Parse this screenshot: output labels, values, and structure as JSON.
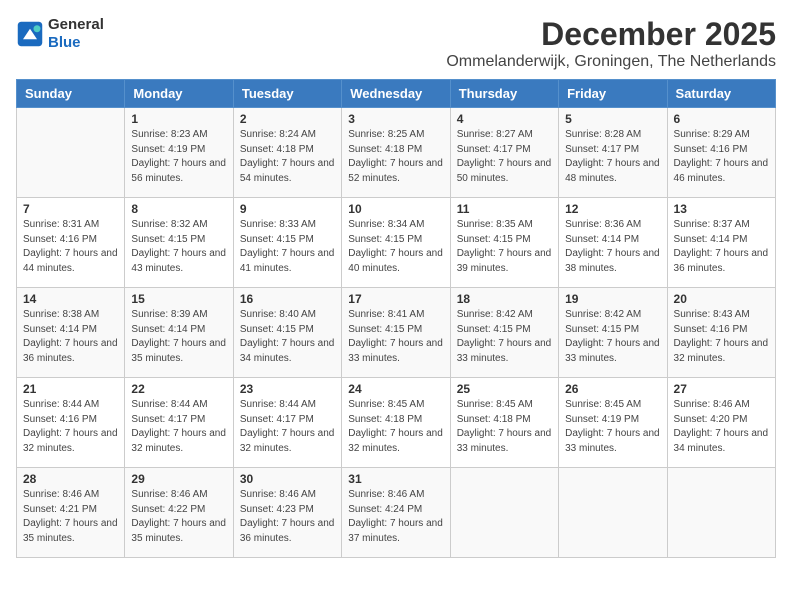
{
  "logo": {
    "line1": "General",
    "line2": "Blue"
  },
  "header": {
    "month": "December 2025",
    "location": "Ommelanderwijk, Groningen, The Netherlands"
  },
  "weekdays": [
    "Sunday",
    "Monday",
    "Tuesday",
    "Wednesday",
    "Thursday",
    "Friday",
    "Saturday"
  ],
  "weeks": [
    [
      {
        "day": "",
        "sunrise": "",
        "sunset": "",
        "daylight": ""
      },
      {
        "day": "1",
        "sunrise": "Sunrise: 8:23 AM",
        "sunset": "Sunset: 4:19 PM",
        "daylight": "Daylight: 7 hours and 56 minutes."
      },
      {
        "day": "2",
        "sunrise": "Sunrise: 8:24 AM",
        "sunset": "Sunset: 4:18 PM",
        "daylight": "Daylight: 7 hours and 54 minutes."
      },
      {
        "day": "3",
        "sunrise": "Sunrise: 8:25 AM",
        "sunset": "Sunset: 4:18 PM",
        "daylight": "Daylight: 7 hours and 52 minutes."
      },
      {
        "day": "4",
        "sunrise": "Sunrise: 8:27 AM",
        "sunset": "Sunset: 4:17 PM",
        "daylight": "Daylight: 7 hours and 50 minutes."
      },
      {
        "day": "5",
        "sunrise": "Sunrise: 8:28 AM",
        "sunset": "Sunset: 4:17 PM",
        "daylight": "Daylight: 7 hours and 48 minutes."
      },
      {
        "day": "6",
        "sunrise": "Sunrise: 8:29 AM",
        "sunset": "Sunset: 4:16 PM",
        "daylight": "Daylight: 7 hours and 46 minutes."
      }
    ],
    [
      {
        "day": "7",
        "sunrise": "Sunrise: 8:31 AM",
        "sunset": "Sunset: 4:16 PM",
        "daylight": "Daylight: 7 hours and 44 minutes."
      },
      {
        "day": "8",
        "sunrise": "Sunrise: 8:32 AM",
        "sunset": "Sunset: 4:15 PM",
        "daylight": "Daylight: 7 hours and 43 minutes."
      },
      {
        "day": "9",
        "sunrise": "Sunrise: 8:33 AM",
        "sunset": "Sunset: 4:15 PM",
        "daylight": "Daylight: 7 hours and 41 minutes."
      },
      {
        "day": "10",
        "sunrise": "Sunrise: 8:34 AM",
        "sunset": "Sunset: 4:15 PM",
        "daylight": "Daylight: 7 hours and 40 minutes."
      },
      {
        "day": "11",
        "sunrise": "Sunrise: 8:35 AM",
        "sunset": "Sunset: 4:15 PM",
        "daylight": "Daylight: 7 hours and 39 minutes."
      },
      {
        "day": "12",
        "sunrise": "Sunrise: 8:36 AM",
        "sunset": "Sunset: 4:14 PM",
        "daylight": "Daylight: 7 hours and 38 minutes."
      },
      {
        "day": "13",
        "sunrise": "Sunrise: 8:37 AM",
        "sunset": "Sunset: 4:14 PM",
        "daylight": "Daylight: 7 hours and 36 minutes."
      }
    ],
    [
      {
        "day": "14",
        "sunrise": "Sunrise: 8:38 AM",
        "sunset": "Sunset: 4:14 PM",
        "daylight": "Daylight: 7 hours and 36 minutes."
      },
      {
        "day": "15",
        "sunrise": "Sunrise: 8:39 AM",
        "sunset": "Sunset: 4:14 PM",
        "daylight": "Daylight: 7 hours and 35 minutes."
      },
      {
        "day": "16",
        "sunrise": "Sunrise: 8:40 AM",
        "sunset": "Sunset: 4:15 PM",
        "daylight": "Daylight: 7 hours and 34 minutes."
      },
      {
        "day": "17",
        "sunrise": "Sunrise: 8:41 AM",
        "sunset": "Sunset: 4:15 PM",
        "daylight": "Daylight: 7 hours and 33 minutes."
      },
      {
        "day": "18",
        "sunrise": "Sunrise: 8:42 AM",
        "sunset": "Sunset: 4:15 PM",
        "daylight": "Daylight: 7 hours and 33 minutes."
      },
      {
        "day": "19",
        "sunrise": "Sunrise: 8:42 AM",
        "sunset": "Sunset: 4:15 PM",
        "daylight": "Daylight: 7 hours and 33 minutes."
      },
      {
        "day": "20",
        "sunrise": "Sunrise: 8:43 AM",
        "sunset": "Sunset: 4:16 PM",
        "daylight": "Daylight: 7 hours and 32 minutes."
      }
    ],
    [
      {
        "day": "21",
        "sunrise": "Sunrise: 8:44 AM",
        "sunset": "Sunset: 4:16 PM",
        "daylight": "Daylight: 7 hours and 32 minutes."
      },
      {
        "day": "22",
        "sunrise": "Sunrise: 8:44 AM",
        "sunset": "Sunset: 4:17 PM",
        "daylight": "Daylight: 7 hours and 32 minutes."
      },
      {
        "day": "23",
        "sunrise": "Sunrise: 8:44 AM",
        "sunset": "Sunset: 4:17 PM",
        "daylight": "Daylight: 7 hours and 32 minutes."
      },
      {
        "day": "24",
        "sunrise": "Sunrise: 8:45 AM",
        "sunset": "Sunset: 4:18 PM",
        "daylight": "Daylight: 7 hours and 32 minutes."
      },
      {
        "day": "25",
        "sunrise": "Sunrise: 8:45 AM",
        "sunset": "Sunset: 4:18 PM",
        "daylight": "Daylight: 7 hours and 33 minutes."
      },
      {
        "day": "26",
        "sunrise": "Sunrise: 8:45 AM",
        "sunset": "Sunset: 4:19 PM",
        "daylight": "Daylight: 7 hours and 33 minutes."
      },
      {
        "day": "27",
        "sunrise": "Sunrise: 8:46 AM",
        "sunset": "Sunset: 4:20 PM",
        "daylight": "Daylight: 7 hours and 34 minutes."
      }
    ],
    [
      {
        "day": "28",
        "sunrise": "Sunrise: 8:46 AM",
        "sunset": "Sunset: 4:21 PM",
        "daylight": "Daylight: 7 hours and 35 minutes."
      },
      {
        "day": "29",
        "sunrise": "Sunrise: 8:46 AM",
        "sunset": "Sunset: 4:22 PM",
        "daylight": "Daylight: 7 hours and 35 minutes."
      },
      {
        "day": "30",
        "sunrise": "Sunrise: 8:46 AM",
        "sunset": "Sunset: 4:23 PM",
        "daylight": "Daylight: 7 hours and 36 minutes."
      },
      {
        "day": "31",
        "sunrise": "Sunrise: 8:46 AM",
        "sunset": "Sunset: 4:24 PM",
        "daylight": "Daylight: 7 hours and 37 minutes."
      },
      {
        "day": "",
        "sunrise": "",
        "sunset": "",
        "daylight": ""
      },
      {
        "day": "",
        "sunrise": "",
        "sunset": "",
        "daylight": ""
      },
      {
        "day": "",
        "sunrise": "",
        "sunset": "",
        "daylight": ""
      }
    ]
  ]
}
